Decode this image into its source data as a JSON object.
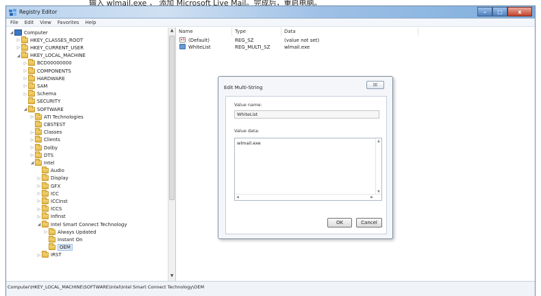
{
  "caption": "输入 wlmail.exe ， 添加 Microsoft Live Mail。完成后，重启电脑。",
  "window": {
    "title": "Registry Editor",
    "controls": [
      "–",
      "□",
      "x"
    ]
  },
  "menu": [
    "File",
    "Edit",
    "View",
    "Favorites",
    "Help"
  ],
  "tree": [
    {
      "label": "Computer",
      "level": 0,
      "arrow": "◢",
      "type": "pc"
    },
    {
      "label": "HKEY_CLASSES_ROOT",
      "level": 1,
      "arrow": "▷"
    },
    {
      "label": "HKEY_CURRENT_USER",
      "level": 1,
      "arrow": "▷"
    },
    {
      "label": "HKEY_LOCAL_MACHINE",
      "level": 1,
      "arrow": "◢"
    },
    {
      "label": "BCD00000000",
      "level": 2,
      "arrow": "▷"
    },
    {
      "label": "COMPONENTS",
      "level": 2,
      "arrow": "▷"
    },
    {
      "label": "HARDWARE",
      "level": 2,
      "arrow": "▷"
    },
    {
      "label": "SAM",
      "level": 2,
      "arrow": "▷"
    },
    {
      "label": "Schema",
      "level": 2,
      "arrow": "▷"
    },
    {
      "label": "SECURITY",
      "level": 2,
      "arrow": ""
    },
    {
      "label": "SOFTWARE",
      "level": 2,
      "arrow": "◢"
    },
    {
      "label": "ATI Technologies",
      "level": 3,
      "arrow": "▷"
    },
    {
      "label": "CBSTEST",
      "level": 3,
      "arrow": ""
    },
    {
      "label": "Classes",
      "level": 3,
      "arrow": "▷"
    },
    {
      "label": "Clients",
      "level": 3,
      "arrow": "▷"
    },
    {
      "label": "Dolby",
      "level": 3,
      "arrow": "▷"
    },
    {
      "label": "DTS",
      "level": 3,
      "arrow": "▷"
    },
    {
      "label": "Intel",
      "level": 3,
      "arrow": "◢"
    },
    {
      "label": "Audio",
      "level": 4,
      "arrow": ""
    },
    {
      "label": "Display",
      "level": 4,
      "arrow": "▷"
    },
    {
      "label": "GFX",
      "level": 4,
      "arrow": "▷"
    },
    {
      "label": "ICC",
      "level": 4,
      "arrow": "▷"
    },
    {
      "label": "ICCInst",
      "level": 4,
      "arrow": "▷"
    },
    {
      "label": "ICCS",
      "level": 4,
      "arrow": "▷"
    },
    {
      "label": "Infinst",
      "level": 4,
      "arrow": "▷"
    },
    {
      "label": "Intel Smart Connect Technology",
      "level": 4,
      "arrow": "◢"
    },
    {
      "label": "Always Updated",
      "level": 5,
      "arrow": "▷"
    },
    {
      "label": "Instant On",
      "level": 5,
      "arrow": ""
    },
    {
      "label": "OEM",
      "level": 5,
      "arrow": "",
      "selected": true
    },
    {
      "label": "IRST",
      "level": 4,
      "arrow": "▷"
    }
  ],
  "list": {
    "columns": [
      "Name",
      "Type",
      "Data"
    ],
    "rows": [
      {
        "name": "(Default)",
        "type": "REG_SZ",
        "data": "(value not set)",
        "icon": "string-value-icon"
      },
      {
        "name": "WhiteList",
        "type": "REG_MULTI_SZ",
        "data": "wlmail.exe",
        "icon": "multi-string-value-icon"
      }
    ]
  },
  "dialog": {
    "title": "Edit Multi-String",
    "close_label": "☒",
    "value_name_label": "Value name:",
    "value_name": "WhiteList",
    "value_data_label": "Value data:",
    "value_data": "wlmail.exe",
    "ok_label": "OK",
    "cancel_label": "Cancel"
  },
  "status": "Computer\\HKEY_LOCAL_MACHINE\\SOFTWARE\\Intel\\Intel Smart Connect Technology\\OEM"
}
